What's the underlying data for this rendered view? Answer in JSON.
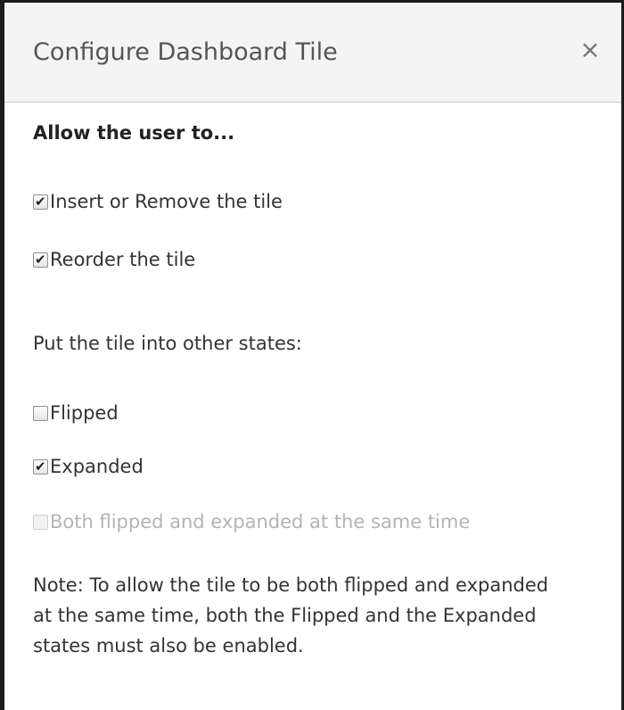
{
  "dialog": {
    "title": "Configure Dashboard Tile",
    "close_glyph": "×",
    "heading": "Allow the user to...",
    "permissions": [
      {
        "label": "Insert or Remove the tile",
        "checked": true
      },
      {
        "label": "Reorder the tile",
        "checked": true
      }
    ],
    "states_label": "Put the tile into other states:",
    "states": [
      {
        "label": "Flipped",
        "checked": false,
        "disabled": false
      },
      {
        "label": "Expanded",
        "checked": true,
        "disabled": false
      },
      {
        "label": "Both flipped and expanded at the same time",
        "checked": false,
        "disabled": true
      }
    ],
    "note": "Note: To allow the tile to be both flipped and expanded at the same time, both the Flipped and the Expanded states must also be enabled.",
    "check_glyph": "✔"
  },
  "colors": {
    "header_bg": "#f4f4f4",
    "text": "#333333",
    "disabled_text": "#b4b4b4",
    "border": "#1b1b1b"
  },
  "icons": {
    "close": "close-icon",
    "check": "checkmark-icon"
  }
}
